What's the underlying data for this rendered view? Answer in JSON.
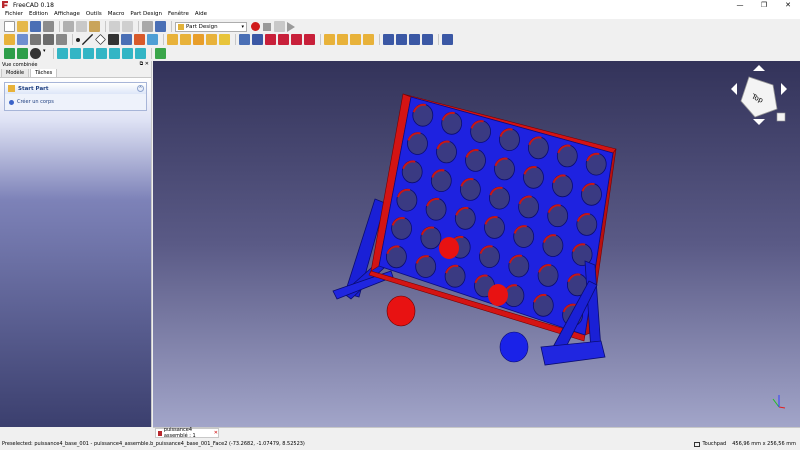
{
  "window": {
    "title": "FreeCAD 0.18",
    "minimize": "—",
    "maximize": "❐",
    "close": "✕"
  },
  "menu": [
    "Fichier",
    "Edition",
    "Affichage",
    "Outils",
    "Macro",
    "Part Design",
    "Fenêtre",
    "Aide"
  ],
  "toolbar": {
    "workbench_selected": "Part Design"
  },
  "combo_view": {
    "title": "Vue combinée",
    "controls": "⧉ ✕",
    "tabs": [
      "Modèle",
      "Tâches"
    ],
    "active_tab": "Tâches",
    "task_title": "Start Part",
    "task_action": "Créer un corps",
    "collapse_glyph": "⌃"
  },
  "navcube": {
    "face_label": "Top"
  },
  "document_tab": {
    "label": "puissance4 assemblé : 1",
    "close": "✕"
  },
  "statusbar": {
    "preselected": "Preselected: puissance4_base_001 - puissance4_assemble.b_puissance4_base_001_Face2 (-73.2682, -1.07479, 8.52523)",
    "nav_style": "Touchpad",
    "dimensions": "456,96 mm x 256,56 mm"
  },
  "colors": {
    "board_blue": "#1e22e0",
    "frame_red": "#d41414",
    "token_red": "#e81212",
    "token_blue": "#1a22e8"
  }
}
